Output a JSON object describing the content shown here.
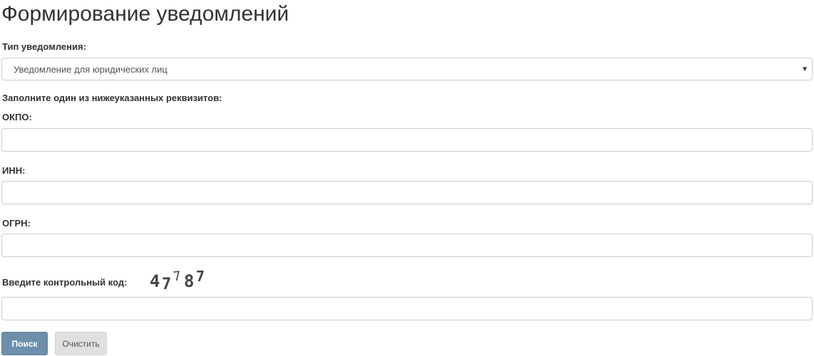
{
  "page": {
    "title": "Формирование уведомлений"
  },
  "notification_type": {
    "label": "Тип уведомления:",
    "selected": "Уведомление для юридических лиц",
    "caret": "▼"
  },
  "requisites": {
    "hint": "Заполните один из нижеуказанных реквизитов:",
    "okpo": {
      "label": "ОКПО:",
      "value": "",
      "placeholder": ""
    },
    "inn": {
      "label": "ИНН:",
      "value": "",
      "placeholder": ""
    },
    "ogrn": {
      "label": "ОГРН:",
      "value": "",
      "placeholder": ""
    }
  },
  "captcha": {
    "label": "Введите контрольный код:",
    "code": "47787",
    "value": "",
    "placeholder": ""
  },
  "buttons": {
    "search_label": "Поиск",
    "clear_label": "Очистить"
  },
  "colors": {
    "primary_button": "#6e8fac",
    "secondary_button": "#e0e0e0",
    "text": "#333333",
    "border": "#cccccc"
  }
}
